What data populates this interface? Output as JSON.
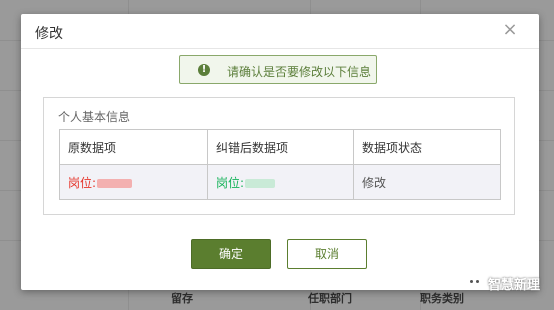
{
  "background": {
    "footer_cells": [
      "留存",
      "任职部门",
      "职务类别"
    ]
  },
  "modal": {
    "title": "修改",
    "close_icon": "close-icon",
    "notice": {
      "icon": "exclamation-circle-icon",
      "text": "请确认是否要修改以下信息"
    },
    "section": {
      "title": "个人基本信息",
      "columns": [
        "原数据项",
        "纠错后数据项",
        "数据项状态"
      ],
      "rows": [
        {
          "original": "岗位:",
          "corrected": "岗位:",
          "status": "修改"
        }
      ]
    },
    "buttons": {
      "confirm": "确定",
      "cancel": "取消"
    }
  },
  "watermark": {
    "text": "智慧新理",
    "icon": "wechat-icon"
  },
  "colors": {
    "primary": "#5b7e2f",
    "notice_bg": "#f1f6ec",
    "red": "#e6352b",
    "green": "#16b35a"
  }
}
